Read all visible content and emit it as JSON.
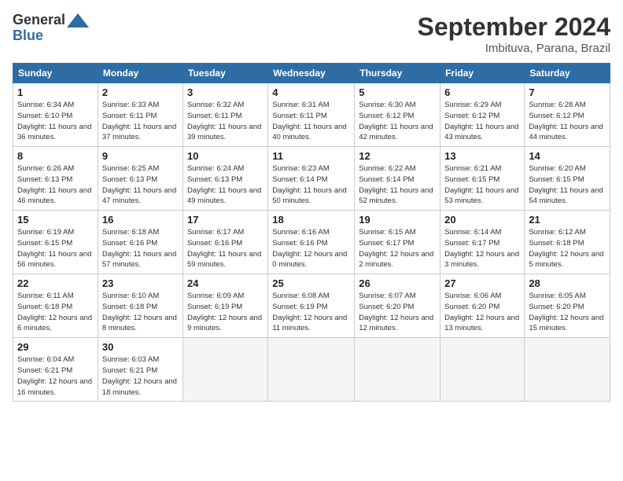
{
  "header": {
    "logo_line1": "General",
    "logo_line2": "Blue",
    "month_title": "September 2024",
    "location": "Imbituva, Parana, Brazil"
  },
  "days_of_week": [
    "Sunday",
    "Monday",
    "Tuesday",
    "Wednesday",
    "Thursday",
    "Friday",
    "Saturday"
  ],
  "weeks": [
    [
      {
        "day": "1",
        "info": "Sunrise: 6:34 AM\nSunset: 6:10 PM\nDaylight: 11 hours\nand 36 minutes."
      },
      {
        "day": "2",
        "info": "Sunrise: 6:33 AM\nSunset: 6:11 PM\nDaylight: 11 hours\nand 37 minutes."
      },
      {
        "day": "3",
        "info": "Sunrise: 6:32 AM\nSunset: 6:11 PM\nDaylight: 11 hours\nand 39 minutes."
      },
      {
        "day": "4",
        "info": "Sunrise: 6:31 AM\nSunset: 6:11 PM\nDaylight: 11 hours\nand 40 minutes."
      },
      {
        "day": "5",
        "info": "Sunrise: 6:30 AM\nSunset: 6:12 PM\nDaylight: 11 hours\nand 42 minutes."
      },
      {
        "day": "6",
        "info": "Sunrise: 6:29 AM\nSunset: 6:12 PM\nDaylight: 11 hours\nand 43 minutes."
      },
      {
        "day": "7",
        "info": "Sunrise: 6:28 AM\nSunset: 6:12 PM\nDaylight: 11 hours\nand 44 minutes."
      }
    ],
    [
      {
        "day": "8",
        "info": "Sunrise: 6:26 AM\nSunset: 6:13 PM\nDaylight: 11 hours\nand 46 minutes."
      },
      {
        "day": "9",
        "info": "Sunrise: 6:25 AM\nSunset: 6:13 PM\nDaylight: 11 hours\nand 47 minutes."
      },
      {
        "day": "10",
        "info": "Sunrise: 6:24 AM\nSunset: 6:13 PM\nDaylight: 11 hours\nand 49 minutes."
      },
      {
        "day": "11",
        "info": "Sunrise: 6:23 AM\nSunset: 6:14 PM\nDaylight: 11 hours\nand 50 minutes."
      },
      {
        "day": "12",
        "info": "Sunrise: 6:22 AM\nSunset: 6:14 PM\nDaylight: 11 hours\nand 52 minutes."
      },
      {
        "day": "13",
        "info": "Sunrise: 6:21 AM\nSunset: 6:15 PM\nDaylight: 11 hours\nand 53 minutes."
      },
      {
        "day": "14",
        "info": "Sunrise: 6:20 AM\nSunset: 6:15 PM\nDaylight: 11 hours\nand 54 minutes."
      }
    ],
    [
      {
        "day": "15",
        "info": "Sunrise: 6:19 AM\nSunset: 6:15 PM\nDaylight: 11 hours\nand 56 minutes."
      },
      {
        "day": "16",
        "info": "Sunrise: 6:18 AM\nSunset: 6:16 PM\nDaylight: 11 hours\nand 57 minutes."
      },
      {
        "day": "17",
        "info": "Sunrise: 6:17 AM\nSunset: 6:16 PM\nDaylight: 11 hours\nand 59 minutes."
      },
      {
        "day": "18",
        "info": "Sunrise: 6:16 AM\nSunset: 6:16 PM\nDaylight: 12 hours\nand 0 minutes."
      },
      {
        "day": "19",
        "info": "Sunrise: 6:15 AM\nSunset: 6:17 PM\nDaylight: 12 hours\nand 2 minutes."
      },
      {
        "day": "20",
        "info": "Sunrise: 6:14 AM\nSunset: 6:17 PM\nDaylight: 12 hours\nand 3 minutes."
      },
      {
        "day": "21",
        "info": "Sunrise: 6:12 AM\nSunset: 6:18 PM\nDaylight: 12 hours\nand 5 minutes."
      }
    ],
    [
      {
        "day": "22",
        "info": "Sunrise: 6:11 AM\nSunset: 6:18 PM\nDaylight: 12 hours\nand 6 minutes."
      },
      {
        "day": "23",
        "info": "Sunrise: 6:10 AM\nSunset: 6:18 PM\nDaylight: 12 hours\nand 8 minutes."
      },
      {
        "day": "24",
        "info": "Sunrise: 6:09 AM\nSunset: 6:19 PM\nDaylight: 12 hours\nand 9 minutes."
      },
      {
        "day": "25",
        "info": "Sunrise: 6:08 AM\nSunset: 6:19 PM\nDaylight: 12 hours\nand 11 minutes."
      },
      {
        "day": "26",
        "info": "Sunrise: 6:07 AM\nSunset: 6:20 PM\nDaylight: 12 hours\nand 12 minutes."
      },
      {
        "day": "27",
        "info": "Sunrise: 6:06 AM\nSunset: 6:20 PM\nDaylight: 12 hours\nand 13 minutes."
      },
      {
        "day": "28",
        "info": "Sunrise: 6:05 AM\nSunset: 6:20 PM\nDaylight: 12 hours\nand 15 minutes."
      }
    ],
    [
      {
        "day": "29",
        "info": "Sunrise: 6:04 AM\nSunset: 6:21 PM\nDaylight: 12 hours\nand 16 minutes."
      },
      {
        "day": "30",
        "info": "Sunrise: 6:03 AM\nSunset: 6:21 PM\nDaylight: 12 hours\nand 18 minutes."
      },
      null,
      null,
      null,
      null,
      null
    ]
  ]
}
